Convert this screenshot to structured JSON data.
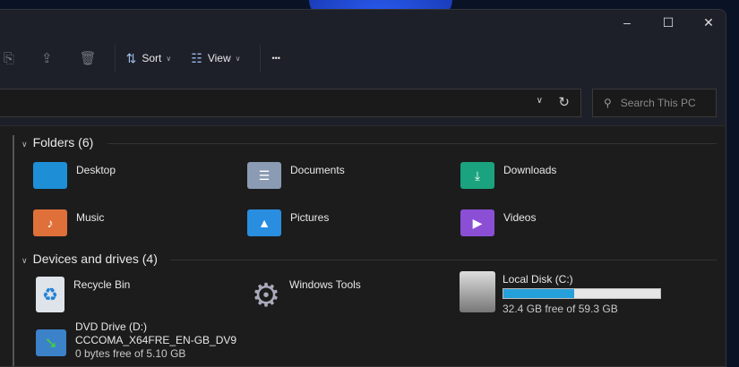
{
  "window": {
    "minimize": "–",
    "maximize": "☐",
    "close": "✕"
  },
  "toolbar": {
    "sort_label": "Sort",
    "view_label": "View",
    "more_label": "•••"
  },
  "address": {
    "search_placeholder": "Search This PC"
  },
  "folders": {
    "header": "Folders (6)",
    "items": [
      {
        "label": "Desktop",
        "color": "#1e8fd6"
      },
      {
        "label": "Documents",
        "color": "#8a9bb3"
      },
      {
        "label": "Downloads",
        "color": "#1aa37e"
      },
      {
        "label": "Music",
        "color": "#e0703a"
      },
      {
        "label": "Pictures",
        "color": "#2a8ee0"
      },
      {
        "label": "Videos",
        "color": "#8b4fd6"
      }
    ]
  },
  "drives": {
    "header": "Devices and drives (4)",
    "recycle": {
      "label": "Recycle Bin"
    },
    "tools": {
      "label": "Windows Tools"
    },
    "local": {
      "label": "Local Disk  (C:)",
      "free": "32.4 GB free of 59.3 GB",
      "used_fraction": 0.454
    },
    "dvd": {
      "label": "DVD Drive (D:)",
      "volume": "CCCOMA_X64FRE_EN-GB_DV9",
      "free": "0 bytes free of 5.10 GB"
    }
  }
}
